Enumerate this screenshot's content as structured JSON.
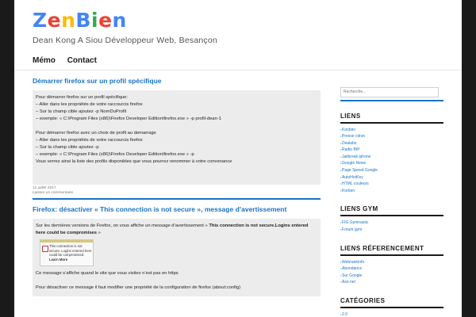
{
  "site": {
    "brand": [
      {
        "ch": "Z",
        "color": "#4285f4"
      },
      {
        "ch": "e",
        "color": "#ea4335"
      },
      {
        "ch": "n",
        "color": "#fbbc05"
      },
      {
        "ch": "B",
        "color": "#4285f4"
      },
      {
        "ch": "i",
        "color": "#34a853"
      },
      {
        "ch": "e",
        "color": "#ea4335"
      },
      {
        "ch": "n",
        "color": "#4285f4"
      }
    ],
    "tagline": "Dean Kong A Siou Développeur Web, Besançon"
  },
  "nav": {
    "items": [
      "Mémo",
      "Contact"
    ]
  },
  "posts": [
    {
      "title": "Démarrer firefox sur un profil spécifique",
      "lines": [
        "Pour démarrer firefox sur un profil spécifique:",
        "– Aller dans les propriétés de votre raccourcis firefox",
        "– Sur la champ cible ajoutez -p NomDuProfil",
        "– exemple: « C:\\Program Files (x86)\\Firefox Developer Edition\\firefox.exe » -p profil-dean-1",
        "",
        "Pour démarrer firefox avec un choix de profil au demarrage",
        "– Aller dans les propriétés de votre raccourcis firefox",
        "– Sur la champ cible ajoutez -p",
        "– exemple: « C:\\Program Files (x86)\\Firefox Developer Edition\\firefox.exe » -p",
        "Vous verrez ainsi la liste des profils disponibles que vous pourrez renommer à votre convenance"
      ],
      "date": "12 juillet 2017",
      "comment": "Laisser un commentaire"
    },
    {
      "title": "Firefox: désactiver « This connection is not secure », message d’avertissement",
      "intro_pre": "Sur les dernières versions de Firefox, on vous affiche un message d’avertissement » ",
      "intro_bold": "This connection is not secure.Logins entered here could be compromises",
      "intro_post": " »",
      "notice_text_1": "This connection is not secure. Logins entered here could be compromised.",
      "notice_link": "Learn More",
      "line_2": "Ce message s’affiche quand le site que vous visitez n’est pas en https",
      "line_3": "Pour désactiver ce message il faut modifier une propriété de la configuration de firefox (about:config)"
    }
  ],
  "sidebar": {
    "search_placeholder": "Recherche…",
    "widgets": [
      {
        "title": "LIENS",
        "items": [
          "Konbini",
          "Presse citron",
          "Dealabs",
          "Radio BIP",
          "Jailbreak iphone",
          "Google News",
          "Page Speed Google",
          "AutoHotKey",
          "HTML couleurs",
          "Korben"
        ]
      },
      {
        "title": "LIENS GYM",
        "items": [
          "FIG Gymnastic",
          "Forum gym"
        ]
      },
      {
        "title": "LIENS RÉFERENCEMENT",
        "items": [
          "WebrankInfo",
          "Abondance",
          "Sur Google",
          "Axe.net"
        ]
      },
      {
        "title": "CATÉGORIES",
        "items": [
          "2.0"
        ]
      }
    ]
  }
}
